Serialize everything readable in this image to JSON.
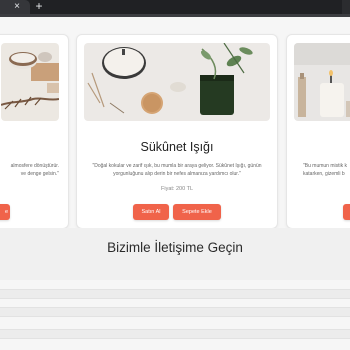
{
  "browser": {
    "tab_close_glyph": "×",
    "new_tab_glyph": "+"
  },
  "cards": {
    "left": {
      "desc_lines": [
        "almosfere dönüştürür.",
        "ve denge gelsin.\""
      ],
      "button_label": "e"
    },
    "center": {
      "title": "Sükûnet Işığı",
      "desc_lines": [
        "\"Doğal kokular ve zarif ışık, bu mumla bir araya geliyor. Sükûnet Işığı, günün",
        "yorgunluğunu alıp derin bir nefes almanıza yardımcı olur.\""
      ],
      "price": "Fiyat: 200 TL",
      "buy_label": "Satın Al",
      "cart_label": "Sepete Ekle"
    },
    "right": {
      "desc_lines": [
        "\"Bu mumun mistik k",
        "katarken, gizemli b"
      ],
      "button_label": ""
    }
  },
  "contact": {
    "title": "Bizimle İletişime Geçin"
  },
  "colors": {
    "accent": "#f0634a",
    "chrome": "#202124",
    "section_bg": "#f0f0f0"
  }
}
